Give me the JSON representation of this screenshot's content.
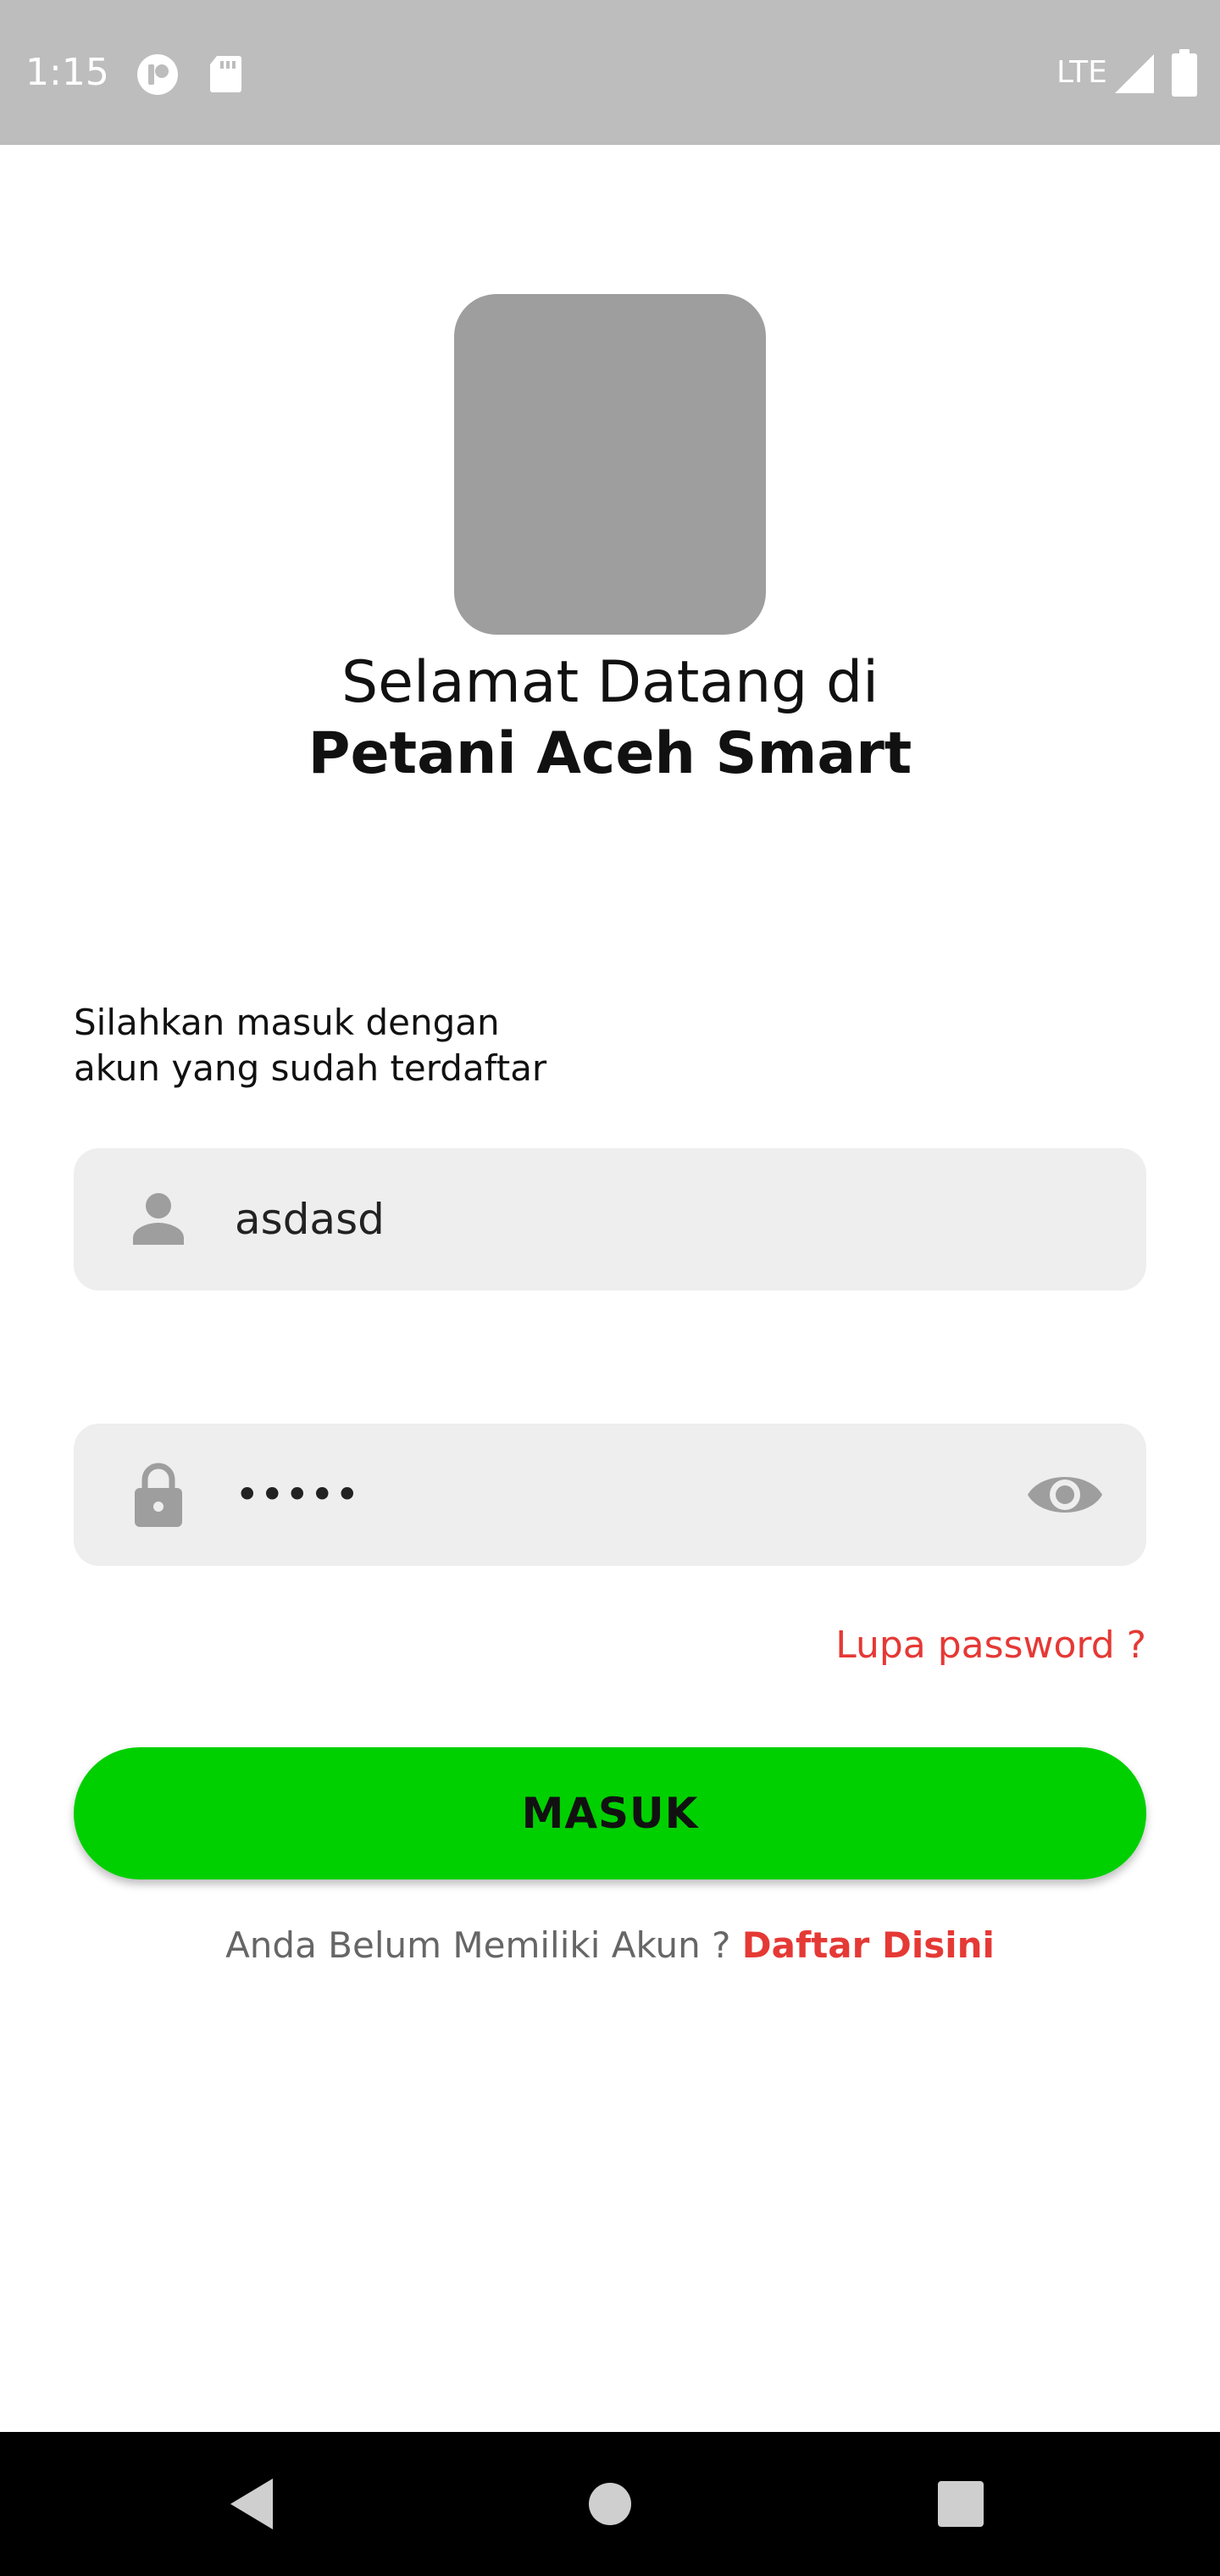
{
  "status_bar": {
    "time": "1:15",
    "network": "LTE",
    "icons": [
      "notification-icon",
      "sd-card-icon",
      "signal-icon",
      "battery-icon"
    ]
  },
  "logo": {
    "icon": "app-logo-placeholder"
  },
  "welcome": {
    "line1": "Selamat Datang di",
    "line2": "Petani Aceh Smart"
  },
  "instruction": {
    "line1": "Silahkan masuk dengan",
    "line2": "akun yang sudah terdaftar"
  },
  "username_field": {
    "value": "asdasd",
    "icon": "person-icon"
  },
  "password_field": {
    "value": "•••••",
    "icon": "lock-icon",
    "toggle_icon": "eye-icon"
  },
  "forgot_password": "Lupa password ?",
  "login_button": "MASUK",
  "register": {
    "prompt": "Anda Belum Memiliki Akun ?",
    "link": "Daftar Disini"
  },
  "colors": {
    "status_bar": "#bdbdbd",
    "field_bg": "#eeeeee",
    "accent_green": "#00d000",
    "link_red": "#e53935",
    "icon_gray": "#9e9e9e"
  },
  "nav_bar": {
    "icons": [
      "back-icon",
      "home-icon",
      "recents-icon"
    ]
  }
}
